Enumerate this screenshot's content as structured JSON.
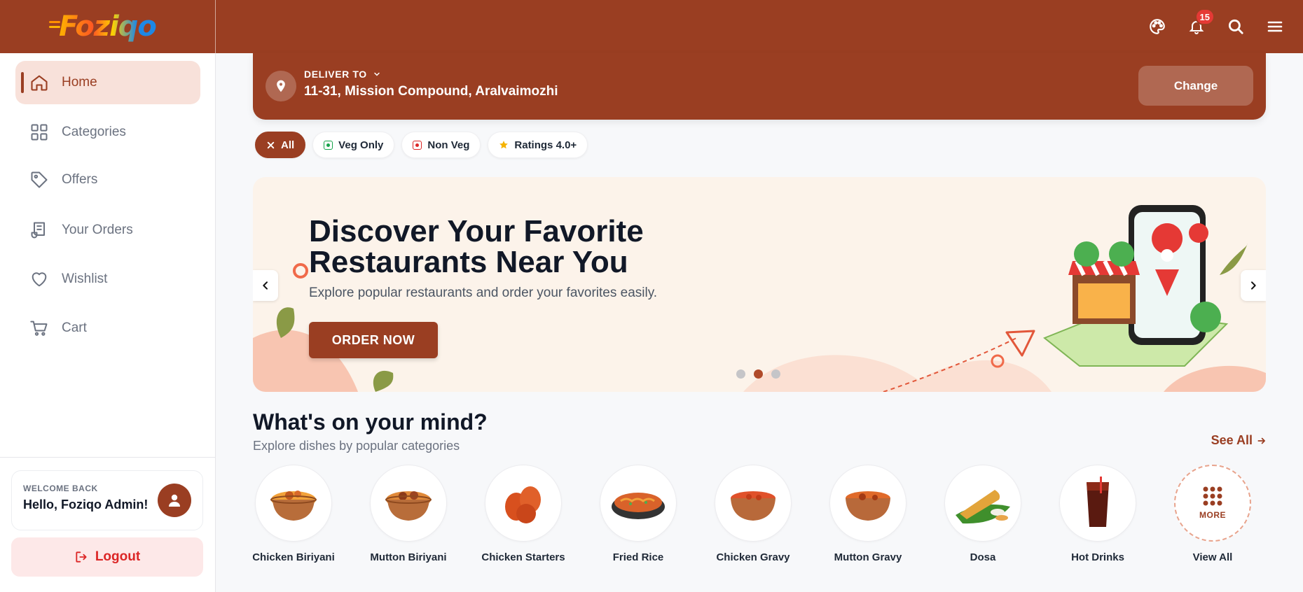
{
  "app": {
    "logo": "Foziqo"
  },
  "topbar": {
    "notification_count": "15",
    "icons": [
      "palette-icon",
      "bell-icon",
      "search-icon",
      "menu-icon"
    ]
  },
  "sidebar": {
    "items": [
      {
        "label": "Home",
        "icon": "home-icon",
        "active": true
      },
      {
        "label": "Categories",
        "icon": "grid-icon"
      },
      {
        "label": "Offers",
        "icon": "tag-icon"
      },
      {
        "label": "Your Orders",
        "icon": "receipt-icon"
      },
      {
        "label": "Wishlist",
        "icon": "heart-icon"
      },
      {
        "label": "Cart",
        "icon": "cart-icon"
      }
    ],
    "welcome_small": "WELCOME BACK",
    "welcome_name": "Hello, Foziqo Admin!",
    "logout_label": "Logout"
  },
  "deliver": {
    "label": "DELIVER TO",
    "address": "11-31, Mission Compound, Aralvaimozhi",
    "change_label": "Change"
  },
  "filters": [
    {
      "label": "All",
      "active": true
    },
    {
      "label": "Veg Only"
    },
    {
      "label": "Non Veg"
    },
    {
      "label": "Ratings 4.0+"
    }
  ],
  "banner": {
    "title_line1": "Discover Your Favorite",
    "title_line2": "Restaurants Near You",
    "subtitle": "Explore popular restaurants and order your favorites easily.",
    "cta": "ORDER NOW",
    "slide_count": 3,
    "active_slide": 2
  },
  "section": {
    "title": "What's on your mind?",
    "subtitle": "Explore dishes by popular categories",
    "see_all": "See All"
  },
  "categories": [
    {
      "label": "Chicken Biriyani"
    },
    {
      "label": "Mutton Biriyani"
    },
    {
      "label": "Chicken Starters"
    },
    {
      "label": "Fried Rice"
    },
    {
      "label": "Chicken Gravy"
    },
    {
      "label": "Mutton Gravy"
    },
    {
      "label": "Dosa"
    },
    {
      "label": "Hot Drinks"
    },
    {
      "label": "View All",
      "more_label": "MORE"
    }
  ],
  "colors": {
    "brand": "#9a3e22",
    "brand_light": "#f8e1da",
    "danger": "#dc2626",
    "veg": "#16a34a",
    "nonveg": "#dc2626",
    "star": "#f5b301"
  }
}
